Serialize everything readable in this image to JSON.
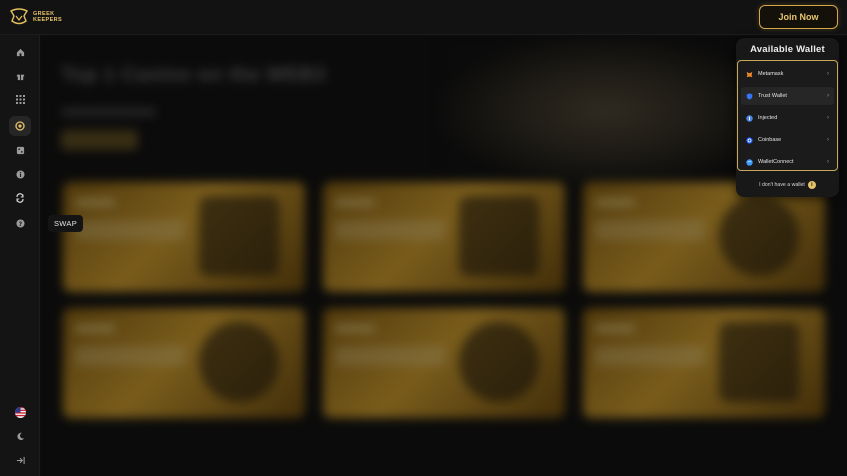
{
  "brand": {
    "name_line1": "GREEK",
    "name_line2": "KEEPERS"
  },
  "header": {
    "join_label": "Join Now"
  },
  "sidebar": {
    "icons": [
      "home-icon",
      "gift-icon",
      "grid-icon",
      "casino-chip-icon",
      "dice-icon",
      "info-icon",
      "swap-icon",
      "help-icon",
      "us-flag-icon",
      "moon-icon",
      "logout-icon"
    ],
    "active": "casino-chip-icon",
    "tooltip": "SWAP"
  },
  "wallet": {
    "title": "Available Wallet",
    "options": [
      {
        "label": "Metamask",
        "icon": "metamask-icon",
        "chevron": "›"
      },
      {
        "label": "Trust Wallet",
        "icon": "trust-wallet-icon",
        "chevron": "›"
      },
      {
        "label": "Injected",
        "icon": "injected-icon",
        "chevron": "›"
      },
      {
        "label": "Coinbase",
        "icon": "coinbase-icon",
        "chevron": "›"
      },
      {
        "label": "WalletConnect",
        "icon": "walletconnect-icon",
        "chevron": "›"
      }
    ],
    "no_wallet": "I don't have a wallet",
    "info_glyph": "i"
  },
  "background": {
    "hero_title": "Top 1 Casino on the WEB3"
  },
  "colors": {
    "accent": "#d4a84a",
    "panel": "#181818",
    "sidebar": "#141414"
  }
}
